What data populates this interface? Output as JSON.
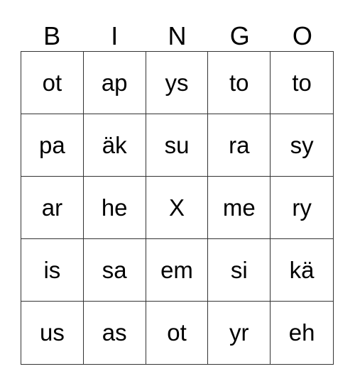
{
  "header": [
    "B",
    "I",
    "N",
    "G",
    "O"
  ],
  "rows": [
    [
      "ot",
      "ap",
      "ys",
      "to",
      "to"
    ],
    [
      "pa",
      "äk",
      "su",
      "ra",
      "sy"
    ],
    [
      "ar",
      "he",
      "X",
      "me",
      "ry"
    ],
    [
      "is",
      "sa",
      "em",
      "si",
      "kä"
    ],
    [
      "us",
      "as",
      "ot",
      "yr",
      "eh"
    ]
  ]
}
